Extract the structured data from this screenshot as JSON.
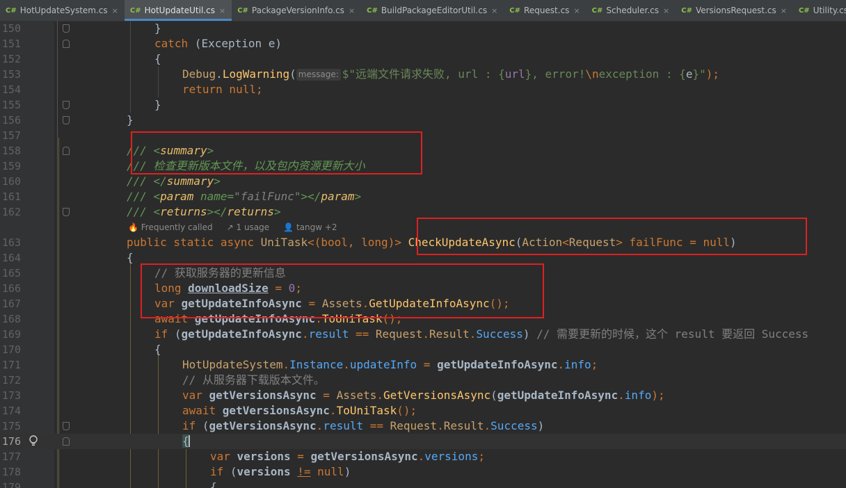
{
  "tabs": [
    {
      "icon": "C#",
      "label": "HotUpdateSystem.cs",
      "active": false,
      "close": "×"
    },
    {
      "icon": "C#",
      "label": "HotUpdateUtil.cs",
      "active": true,
      "close": "×"
    },
    {
      "icon": "C#",
      "label": "PackageVersionInfo.cs",
      "active": false,
      "close": "×"
    },
    {
      "icon": "C#",
      "label": "BuildPackageEditorUtil.cs",
      "active": false,
      "close": "×"
    },
    {
      "icon": "C#",
      "label": "Request.cs",
      "active": false,
      "close": "×"
    },
    {
      "icon": "C#",
      "label": "Scheduler.cs",
      "active": false,
      "close": "×"
    },
    {
      "icon": "C#",
      "label": "VersionsRequest.cs",
      "active": false,
      "close": "×"
    },
    {
      "icon": "C#",
      "label": "Utility.cs",
      "active": false,
      "close": "×"
    }
  ],
  "lines": [
    {
      "n": "150"
    },
    {
      "n": "151"
    },
    {
      "n": "152"
    },
    {
      "n": "153"
    },
    {
      "n": "154"
    },
    {
      "n": "155"
    },
    {
      "n": "156"
    },
    {
      "n": "157"
    },
    {
      "n": "158"
    },
    {
      "n": "159"
    },
    {
      "n": "160"
    },
    {
      "n": "161"
    },
    {
      "n": "162"
    },
    {
      "n": ""
    },
    {
      "n": "163"
    },
    {
      "n": "164"
    },
    {
      "n": "165"
    },
    {
      "n": "166"
    },
    {
      "n": "167"
    },
    {
      "n": "168"
    },
    {
      "n": "169"
    },
    {
      "n": "170"
    },
    {
      "n": "171"
    },
    {
      "n": "172"
    },
    {
      "n": "173"
    },
    {
      "n": "174"
    },
    {
      "n": "175"
    },
    {
      "n": "176"
    },
    {
      "n": "177"
    },
    {
      "n": "178"
    },
    {
      "n": "179"
    }
  ],
  "code_vision": {
    "frequently_called": "Frequently called",
    "usages": "1 usage",
    "authors": "tangw +2"
  },
  "parameter_hint": "message:",
  "code": {
    "l150": "}",
    "l151_kw": "catch",
    "l151_rest": " (Exception e)",
    "l152": "{",
    "l153_a": "Debug",
    "l153_b": ".",
    "l153_c": "LogWarning",
    "l153_d": "(",
    "l153_str1": "$\"远端文件请求失败, url : {",
    "l153_url": "url",
    "l153_str2": "}, error!",
    "l153_esc": "\\n",
    "l153_str3": "exception : {",
    "l153_e": "e",
    "l153_str4": "}\"",
    "l153_end": ");",
    "l154": "return null;",
    "l155": "}",
    "l156": "}",
    "l158_a": "/// <",
    "l158_tag": "summary",
    "l158_b": ">",
    "l159": "/// 检查更新版本文件，以及包内资源更新大小",
    "l160_a": "/// </",
    "l160_tag": "summary",
    "l160_b": ">",
    "l161_a": "/// <",
    "l161_tag": "param",
    "l161_attr": " name=",
    "l161_val": "\"failFunc\"",
    "l161_b": "></",
    "l161_tag2": "param",
    "l161_c": ">",
    "l162_a": "/// <",
    "l162_tag": "returns",
    "l162_b": "></",
    "l162_tag2": "returns",
    "l162_c": ">",
    "l163_kw": "public static async ",
    "l163_type": "UniTask",
    "l163_tuple": "<(bool, long)> ",
    "l163_name": "CheckUpdateAsync",
    "l163_open": "(",
    "l163_action": "Action",
    "l163_lt": "<",
    "l163_req": "Request",
    "l163_gt": "> ",
    "l163_param": "failFunc",
    "l163_eq": " = ",
    "l163_null": "null",
    "l163_close": ")",
    "l164": "{",
    "l165": "// 获取服务器的更新信息",
    "l166_kw": "long ",
    "l166_var": "downloadSize",
    "l166_eq": " = ",
    "l166_num": "0",
    "l166_end": ";",
    "l167_kw": "var ",
    "l167_var": "getUpdateInfoAsync",
    "l167_eq": " = ",
    "l167_cls": "Assets",
    "l167_dot": ".",
    "l167_m": "GetUpdateInfoAsync",
    "l167_end": "();",
    "l168_kw": "await ",
    "l168_var": "getUpdateInfoAsync",
    "l168_dot": ".",
    "l168_m": "ToUniTask",
    "l168_end": "();",
    "l169_kw": "if ",
    "l169_open": "(",
    "l169_var": "getUpdateInfoAsync",
    "l169_dot": ".",
    "l169_prop": "result",
    "l169_eq": " == ",
    "l169_cls": "Request",
    "l169_dot2": ".",
    "l169_cls2": "Result",
    "l169_dot3": ".",
    "l169_en": "Success",
    "l169_close": ") ",
    "l169_cm": "// 需要更新的时候，这个 result 要返回 Success",
    "l170": "{",
    "l171_cls": "HotUpdateSystem",
    "l171_dot": ".",
    "l171_inst": "Instance",
    "l171_dot2": ".",
    "l171_prop": "updateInfo",
    "l171_eq": " = ",
    "l171_var": "getUpdateInfoAsync",
    "l171_dot3": ".",
    "l171_prop2": "info",
    "l171_end": ";",
    "l172": "// 从服务器下载版本文件。",
    "l173_kw": "var ",
    "l173_var": "getVersionsAsync",
    "l173_eq": " = ",
    "l173_cls": "Assets",
    "l173_dot": ".",
    "l173_m": "GetVersionsAsync",
    "l173_open": "(",
    "l173_arg": "getUpdateInfoAsync",
    "l173_dot2": ".",
    "l173_prop": "info",
    "l173_end": ");",
    "l174_kw": "await ",
    "l174_var": "getVersionsAsync",
    "l174_dot": ".",
    "l174_m": "ToUniTask",
    "l174_end": "();",
    "l175_kw": "if ",
    "l175_open": "(",
    "l175_var": "getVersionsAsync",
    "l175_dot": ".",
    "l175_prop": "result",
    "l175_eq": " == ",
    "l175_cls": "Request",
    "l175_dot2": ".",
    "l175_cls2": "Result",
    "l175_dot3": ".",
    "l175_en": "Success",
    "l175_close": ")",
    "l176": "{",
    "l177_kw": "var ",
    "l177_var": "versions",
    "l177_eq": " = ",
    "l177_obj": "getVersionsAsync",
    "l177_dot": ".",
    "l177_prop": "versions",
    "l177_end": ";",
    "l178_kw": "if ",
    "l178_open": "(",
    "l178_var": "versions",
    "l178_sp": " ",
    "l178_ne": "!=",
    "l178_sp2": " ",
    "l178_null": "null",
    "l178_close": ")",
    "l179": "{"
  },
  "colors": {
    "editor_bg": "#2b2b2b",
    "keyword": "#cc7832",
    "string": "#6a8759",
    "comment": "#808080",
    "doc_comment": "#629755",
    "number": "#6897bb",
    "method": "#ffc66d",
    "field": "#9876aa",
    "annotation_box": "#e02020"
  }
}
